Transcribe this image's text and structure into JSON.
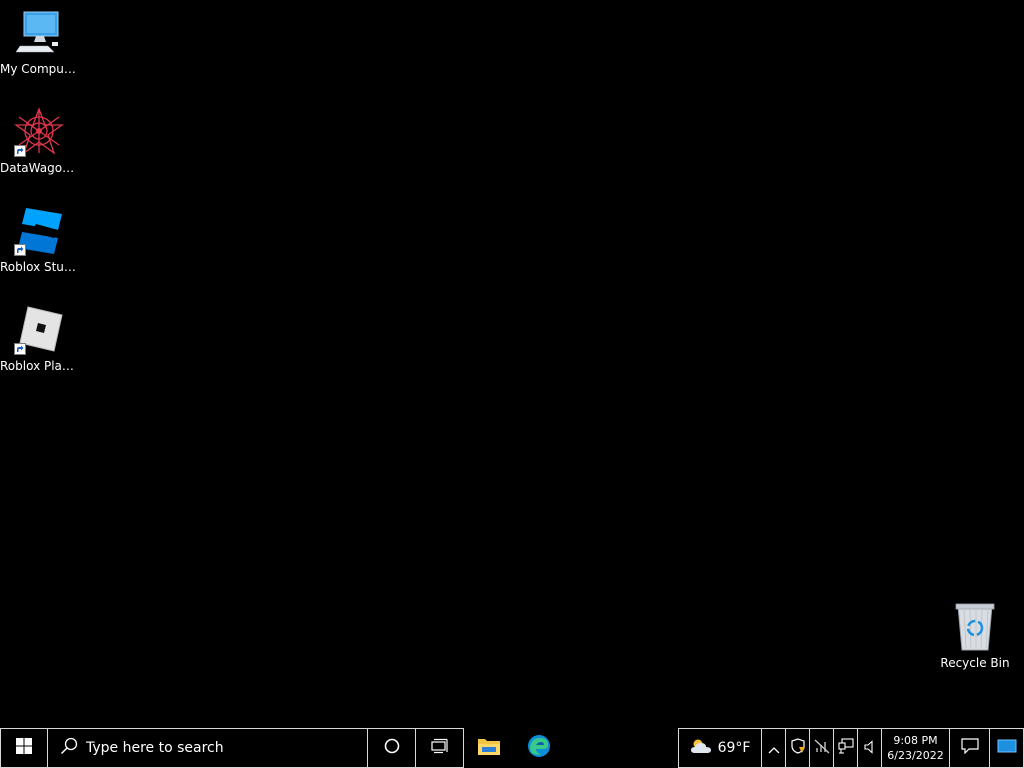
{
  "desktop": {
    "icons": [
      {
        "label": "My Computer"
      },
      {
        "label": "DataWagon..."
      },
      {
        "label": "Roblox Studio"
      },
      {
        "label": "Roblox Player"
      },
      {
        "label": "Recycle Bin"
      }
    ]
  },
  "taskbar": {
    "search_placeholder": "Type here to search",
    "weather_temp": "69°F",
    "clock_time": "9:08 PM",
    "clock_date": "6/23/2022",
    "icons": [
      "windows-start-icon",
      "search-icon",
      "cortana-icon",
      "task-view-icon",
      "file-explorer-icon",
      "edge-icon",
      "weather-cloud-icon",
      "chevron-up-icon",
      "security-icon",
      "network-off-icon",
      "network-icon",
      "speaker-icon",
      "notification-icon",
      "show-desktop-icon"
    ]
  },
  "colors": {
    "background": "#000000",
    "accent": "#0078d7"
  }
}
